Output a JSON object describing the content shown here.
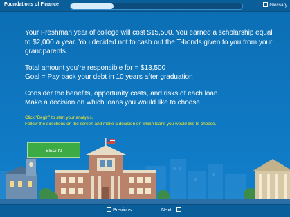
{
  "header": {
    "title": "Foundations of Finance",
    "glossary_label": "Glossary",
    "progress_fraction": 0.25
  },
  "content": {
    "paragraph1": "Your Freshman year of college will cost $15,500. You earned a scholarship equal to $2,000 a year. You decided not to cash out the T-bonds given to you from your grandparents.",
    "total_line": "Total amount you’re responsible for = $13,500",
    "goal_line": "Goal = Pay back your debt in 10 years after graduation",
    "consider_line": "Consider the benefits, opportunity costs, and risks of each loan.",
    "decision_line": "Make a decision on which loans you would like to choose.",
    "instruction1": "Click “Begin” to start your analysis.",
    "instruction2": "Follow the directions on the screen and make a decision on which loans you would like to choose."
  },
  "begin_button": {
    "label": "BEGIN"
  },
  "footer": {
    "previous_label": "Previous",
    "next_label": "Next"
  },
  "colors": {
    "background": "#0d6fb4",
    "bar": "#0a5f9b",
    "accent_yellow": "#f7ea2a",
    "button_green": "#3dab44"
  }
}
